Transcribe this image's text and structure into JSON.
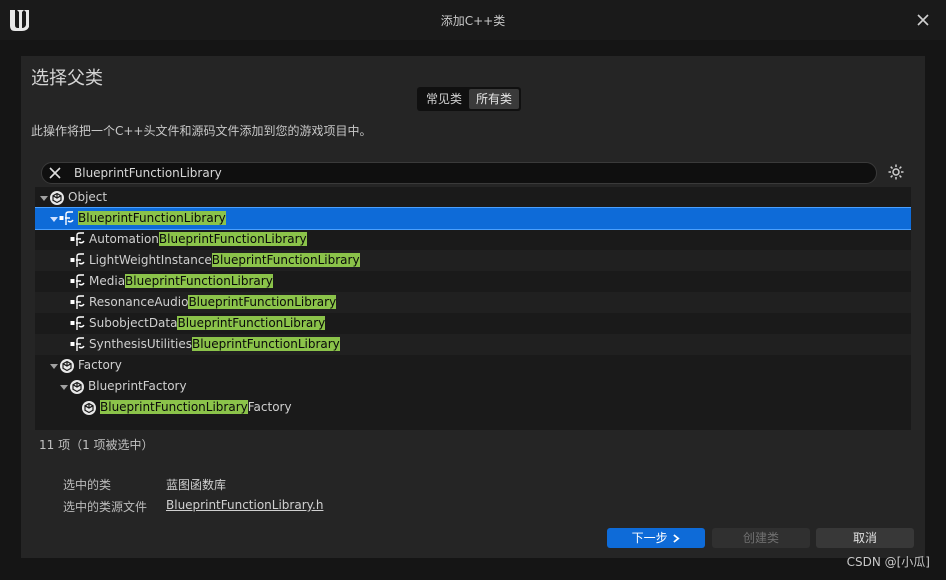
{
  "window": {
    "title": "添加C++类"
  },
  "panel": {
    "heading": "选择父类",
    "tabs": [
      {
        "label": "常见类"
      },
      {
        "label": "所有类"
      }
    ],
    "description": "此操作将把一个C++头文件和源码文件添加到您的游戏项目中。"
  },
  "search": {
    "value": "BlueprintFunctionLibrary"
  },
  "tree": {
    "rows": [
      {
        "prefix": "Object",
        "match": "",
        "suffix": ""
      },
      {
        "prefix": "",
        "match": "BlueprintFunctionLibrary",
        "suffix": ""
      },
      {
        "prefix": "Automation",
        "match": "BlueprintFunctionLibrary",
        "suffix": ""
      },
      {
        "prefix": "LightWeightInstance",
        "match": "BlueprintFunctionLibrary",
        "suffix": ""
      },
      {
        "prefix": "Media",
        "match": "BlueprintFunctionLibrary",
        "suffix": ""
      },
      {
        "prefix": "ResonanceAudio",
        "match": "BlueprintFunctionLibrary",
        "suffix": ""
      },
      {
        "prefix": "SubobjectData",
        "match": "BlueprintFunctionLibrary",
        "suffix": ""
      },
      {
        "prefix": "SynthesisUtilities",
        "match": "BlueprintFunctionLibrary",
        "suffix": ""
      },
      {
        "prefix": "Factory",
        "match": "",
        "suffix": ""
      },
      {
        "prefix": "BlueprintFactory",
        "match": "",
        "suffix": ""
      },
      {
        "prefix": "",
        "match": "BlueprintFunctionLibrary",
        "suffix": "Factory"
      }
    ]
  },
  "status": {
    "count": "11 项（1 项被选中）"
  },
  "selection": {
    "class_label": "选中的类",
    "class_value": "蓝图函数库",
    "source_label": "选中的类源文件",
    "source_value": "BlueprintFunctionLibrary.h"
  },
  "buttons": {
    "next": "下一步",
    "create": "创建类",
    "cancel": "取消"
  },
  "watermark": "CSDN @[小瓜]"
}
